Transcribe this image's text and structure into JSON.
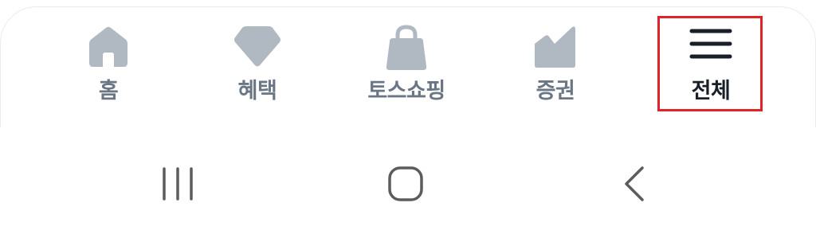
{
  "tabbar": {
    "items": [
      {
        "label": "홈",
        "icon": "home-icon",
        "active": false
      },
      {
        "label": "혜택",
        "icon": "gem-icon",
        "active": false
      },
      {
        "label": "토스쇼핑",
        "icon": "shopping-bag-icon",
        "active": false
      },
      {
        "label": "증권",
        "icon": "stock-chart-icon",
        "active": false
      },
      {
        "label": "전체",
        "icon": "menu-icon",
        "active": true
      }
    ],
    "colors": {
      "inactive_icon": "#b0b8c1",
      "inactive_label": "#6b7684",
      "active": "#191f28",
      "highlight": "#e0222b"
    }
  },
  "system_nav": {
    "buttons": [
      {
        "icon": "recent-apps-icon"
      },
      {
        "icon": "home-button-icon"
      },
      {
        "icon": "back-icon"
      }
    ],
    "color": "#5c5c5c"
  }
}
